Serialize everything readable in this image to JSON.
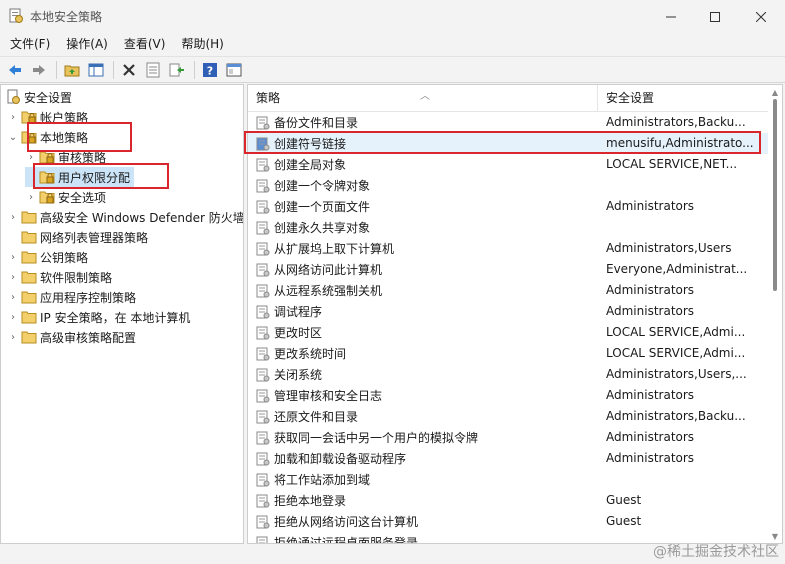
{
  "window": {
    "title": "本地安全策略",
    "minimize_icon": "minimize-icon",
    "maximize_icon": "maximize-icon",
    "close_icon": "close-icon"
  },
  "menu": {
    "items": [
      {
        "label": "文件(F)"
      },
      {
        "label": "操作(A)"
      },
      {
        "label": "查看(V)"
      },
      {
        "label": "帮助(H)"
      }
    ]
  },
  "toolbar": {
    "buttons": [
      "back-icon",
      "forward-icon",
      "up-folder-icon",
      "show-hide-tree-icon",
      "delete-icon",
      "properties-icon",
      "export-icon",
      "help-icon",
      "console-icon"
    ]
  },
  "tree": {
    "root": "安全设置",
    "items": [
      {
        "label": "帐户策略",
        "level": 1,
        "expander": "collapsed"
      },
      {
        "label": "本地策略",
        "level": 1,
        "expander": "expanded"
      },
      {
        "label": "审核策略",
        "level": 2,
        "expander": "collapsed"
      },
      {
        "label": "用户权限分配",
        "level": 2,
        "expander": "none",
        "selected": true
      },
      {
        "label": "安全选项",
        "level": 2,
        "expander": "collapsed"
      },
      {
        "label": "高级安全 Windows Defender 防火墙",
        "level": 1,
        "expander": "collapsed"
      },
      {
        "label": "网络列表管理器策略",
        "level": 1,
        "expander": "none"
      },
      {
        "label": "公钥策略",
        "level": 1,
        "expander": "collapsed"
      },
      {
        "label": "软件限制策略",
        "level": 1,
        "expander": "collapsed"
      },
      {
        "label": "应用程序控制策略",
        "level": 1,
        "expander": "collapsed"
      },
      {
        "label": "IP 安全策略，在 本地计算机",
        "level": 1,
        "expander": "collapsed"
      },
      {
        "label": "高级审核策略配置",
        "level": 1,
        "expander": "collapsed"
      }
    ]
  },
  "list": {
    "columns": {
      "policy": "策略",
      "setting": "安全设置"
    },
    "rows": [
      {
        "policy": "备份文件和目录",
        "setting": "Administrators,Backu..."
      },
      {
        "policy": "创建符号链接",
        "setting": "menusifu,Administrato...",
        "selected": true
      },
      {
        "policy": "创建全局对象",
        "setting": "LOCAL SERVICE,NET..."
      },
      {
        "policy": "创建一个令牌对象",
        "setting": ""
      },
      {
        "policy": "创建一个页面文件",
        "setting": "Administrators"
      },
      {
        "policy": "创建永久共享对象",
        "setting": ""
      },
      {
        "policy": "从扩展坞上取下计算机",
        "setting": "Administrators,Users"
      },
      {
        "policy": "从网络访问此计算机",
        "setting": "Everyone,Administrat..."
      },
      {
        "policy": "从远程系统强制关机",
        "setting": "Administrators"
      },
      {
        "policy": "调试程序",
        "setting": "Administrators"
      },
      {
        "policy": "更改时区",
        "setting": "LOCAL SERVICE,Admi..."
      },
      {
        "policy": "更改系统时间",
        "setting": "LOCAL SERVICE,Admi..."
      },
      {
        "policy": "关闭系统",
        "setting": "Administrators,Users,..."
      },
      {
        "policy": "管理审核和安全日志",
        "setting": "Administrators"
      },
      {
        "policy": "还原文件和目录",
        "setting": "Administrators,Backu..."
      },
      {
        "policy": "获取同一会话中另一个用户的模拟令牌",
        "setting": "Administrators"
      },
      {
        "policy": "加载和卸载设备驱动程序",
        "setting": "Administrators"
      },
      {
        "policy": "将工作站添加到域",
        "setting": ""
      },
      {
        "policy": "拒绝本地登录",
        "setting": "Guest"
      },
      {
        "policy": "拒绝从网络访问这台计算机",
        "setting": "Guest"
      },
      {
        "policy": "拒绝通过远程桌面服务登录",
        "setting": ""
      }
    ]
  },
  "watermark": "@稀土掘金技术社区",
  "colors": {
    "highlight_box": "#d9262c",
    "selection": "#cce4f7",
    "window_bg": "#f3f3f3"
  }
}
